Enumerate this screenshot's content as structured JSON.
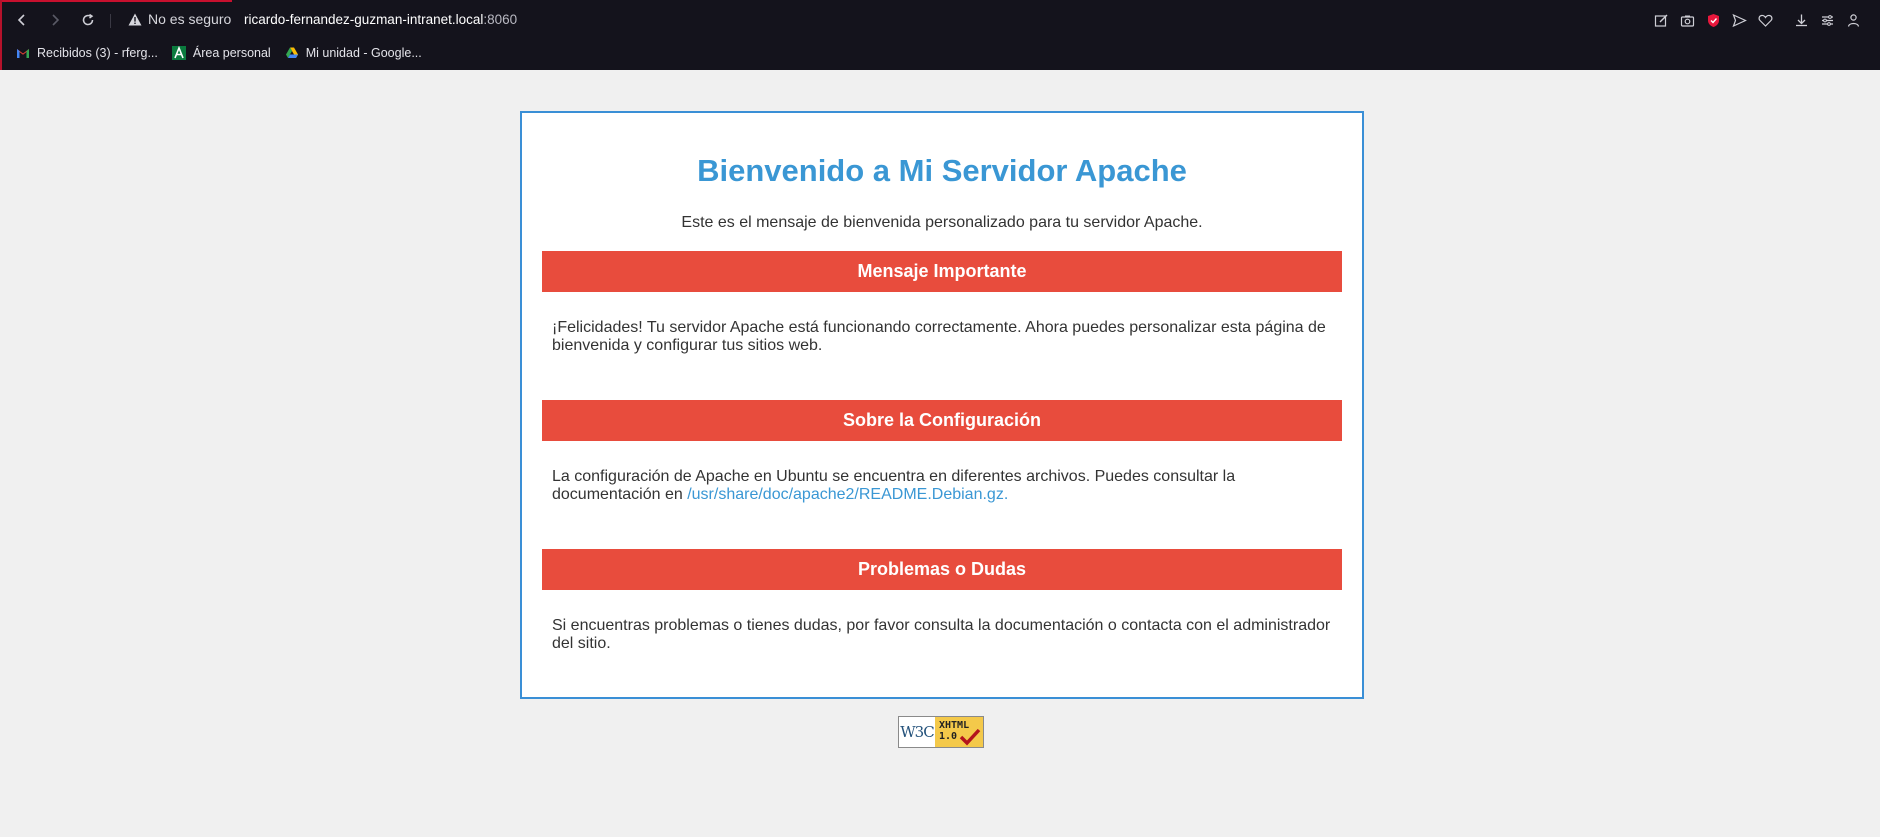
{
  "browser": {
    "security_label": "No es seguro",
    "url_host": "ricardo-fernandez-guzman-intranet.local",
    "url_port": ":8060",
    "bookmarks": [
      {
        "label": "Recibidos (3) - rferg...",
        "icon": "gmail-icon"
      },
      {
        "label": "Área personal",
        "icon": "andalucia-icon"
      },
      {
        "label": "Mi unidad - Google...",
        "icon": "google-drive-icon"
      }
    ]
  },
  "page": {
    "title": "Bienvenido a Mi Servidor Apache",
    "subtitle": "Este es el mensaje de bienvenida personalizado para tu servidor Apache.",
    "sections": [
      {
        "heading": "Mensaje Importante",
        "text_before": "¡Felicidades! Tu servidor Apache está funcionando correctamente. Ahora puedes personalizar esta página de bienvenida y configurar tus sitios web.",
        "link": "",
        "text_after": ""
      },
      {
        "heading": "Sobre la Configuración",
        "text_before": "La configuración de Apache en Ubuntu se encuentra en diferentes archivos. Puedes consultar la documentación en ",
        "link": "/usr/share/doc/apache2/README.Debian.gz",
        "text_after": "."
      },
      {
        "heading": "Problemas o Dudas",
        "text_before": "Si encuentras problemas o tienes dudas, por favor consulta la documentación o contacta con el administrador del sitio.",
        "link": "",
        "text_after": ""
      }
    ],
    "badge": {
      "left": "W3C",
      "right_line1": "XHTML",
      "right_line2": "1.0"
    }
  },
  "colors": {
    "accent_blue": "#3a97d4",
    "section_red": "#e84c3d",
    "badge_yellow": "#f4c94a",
    "chrome_bg": "#14131c"
  }
}
